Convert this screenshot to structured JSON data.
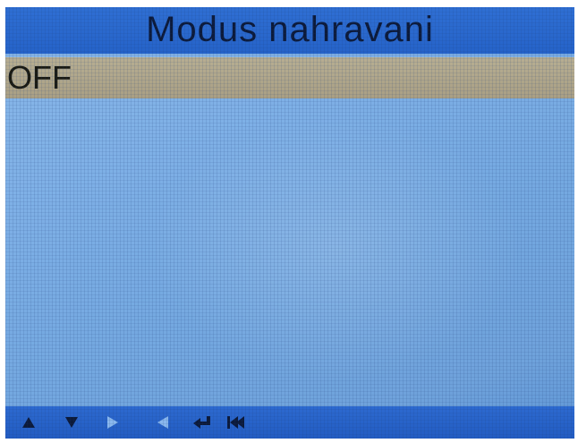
{
  "screen": {
    "title": "Modus nahravani",
    "menu_items": [
      {
        "label": "OFF",
        "selected": true
      }
    ]
  },
  "navigation_bar": {
    "icons": [
      {
        "name": "up-arrow-icon",
        "active": true
      },
      {
        "name": "down-arrow-icon",
        "active": true
      },
      {
        "name": "right-arrow-icon",
        "active": false
      },
      {
        "name": "left-arrow-icon",
        "active": false
      },
      {
        "name": "enter-icon",
        "active": true
      },
      {
        "name": "back-to-start-icon",
        "active": true
      }
    ]
  },
  "colors": {
    "title_bar": "#2563c9",
    "selected_item": "#a99f84",
    "background": "#7fb0e6",
    "icon_active": "#0c1a3a",
    "icon_inactive": "#8ab8ee"
  }
}
